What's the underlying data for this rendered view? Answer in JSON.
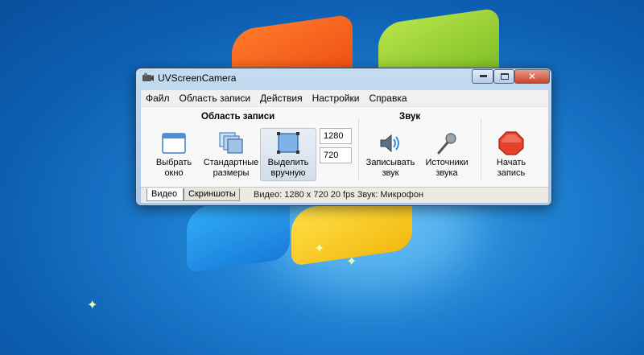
{
  "window": {
    "title": "UVScreenCamera",
    "close_glyph": "✕"
  },
  "menu": [
    "Файл",
    "Область записи",
    "Действия",
    "Настройки",
    "Справка"
  ],
  "toolbar": {
    "area_group_title": "Область записи",
    "sound_group_title": "Звук",
    "buttons": {
      "select_window": "Выбрать\nокно",
      "standard_sizes": "Стандартные\nразмеры",
      "select_manual": "Выделить\nвручную",
      "record_sound": "Записывать\nзвук",
      "sound_sources": "Источники\nзвука",
      "start_recording": "Начать\nзапись"
    },
    "width_value": "1280",
    "height_value": "720"
  },
  "status": {
    "tabs": [
      "Видео",
      "Скриншоты"
    ],
    "active_tab": "Видео",
    "text": "Видео: 1280 x 720  20 fps   Звук: Микрофон"
  },
  "colors": {
    "stop_red": "#e8412a",
    "accent_blue": "#3b8fd6"
  },
  "icons": {
    "app": "camera-icon",
    "select_window": "window-icon",
    "standard_sizes": "stacked-windows-icon",
    "select_manual": "selection-frame-icon",
    "record_sound": "speaker-icon",
    "sound_sources": "microphone-icon",
    "start_recording": "stop-sign-icon"
  }
}
